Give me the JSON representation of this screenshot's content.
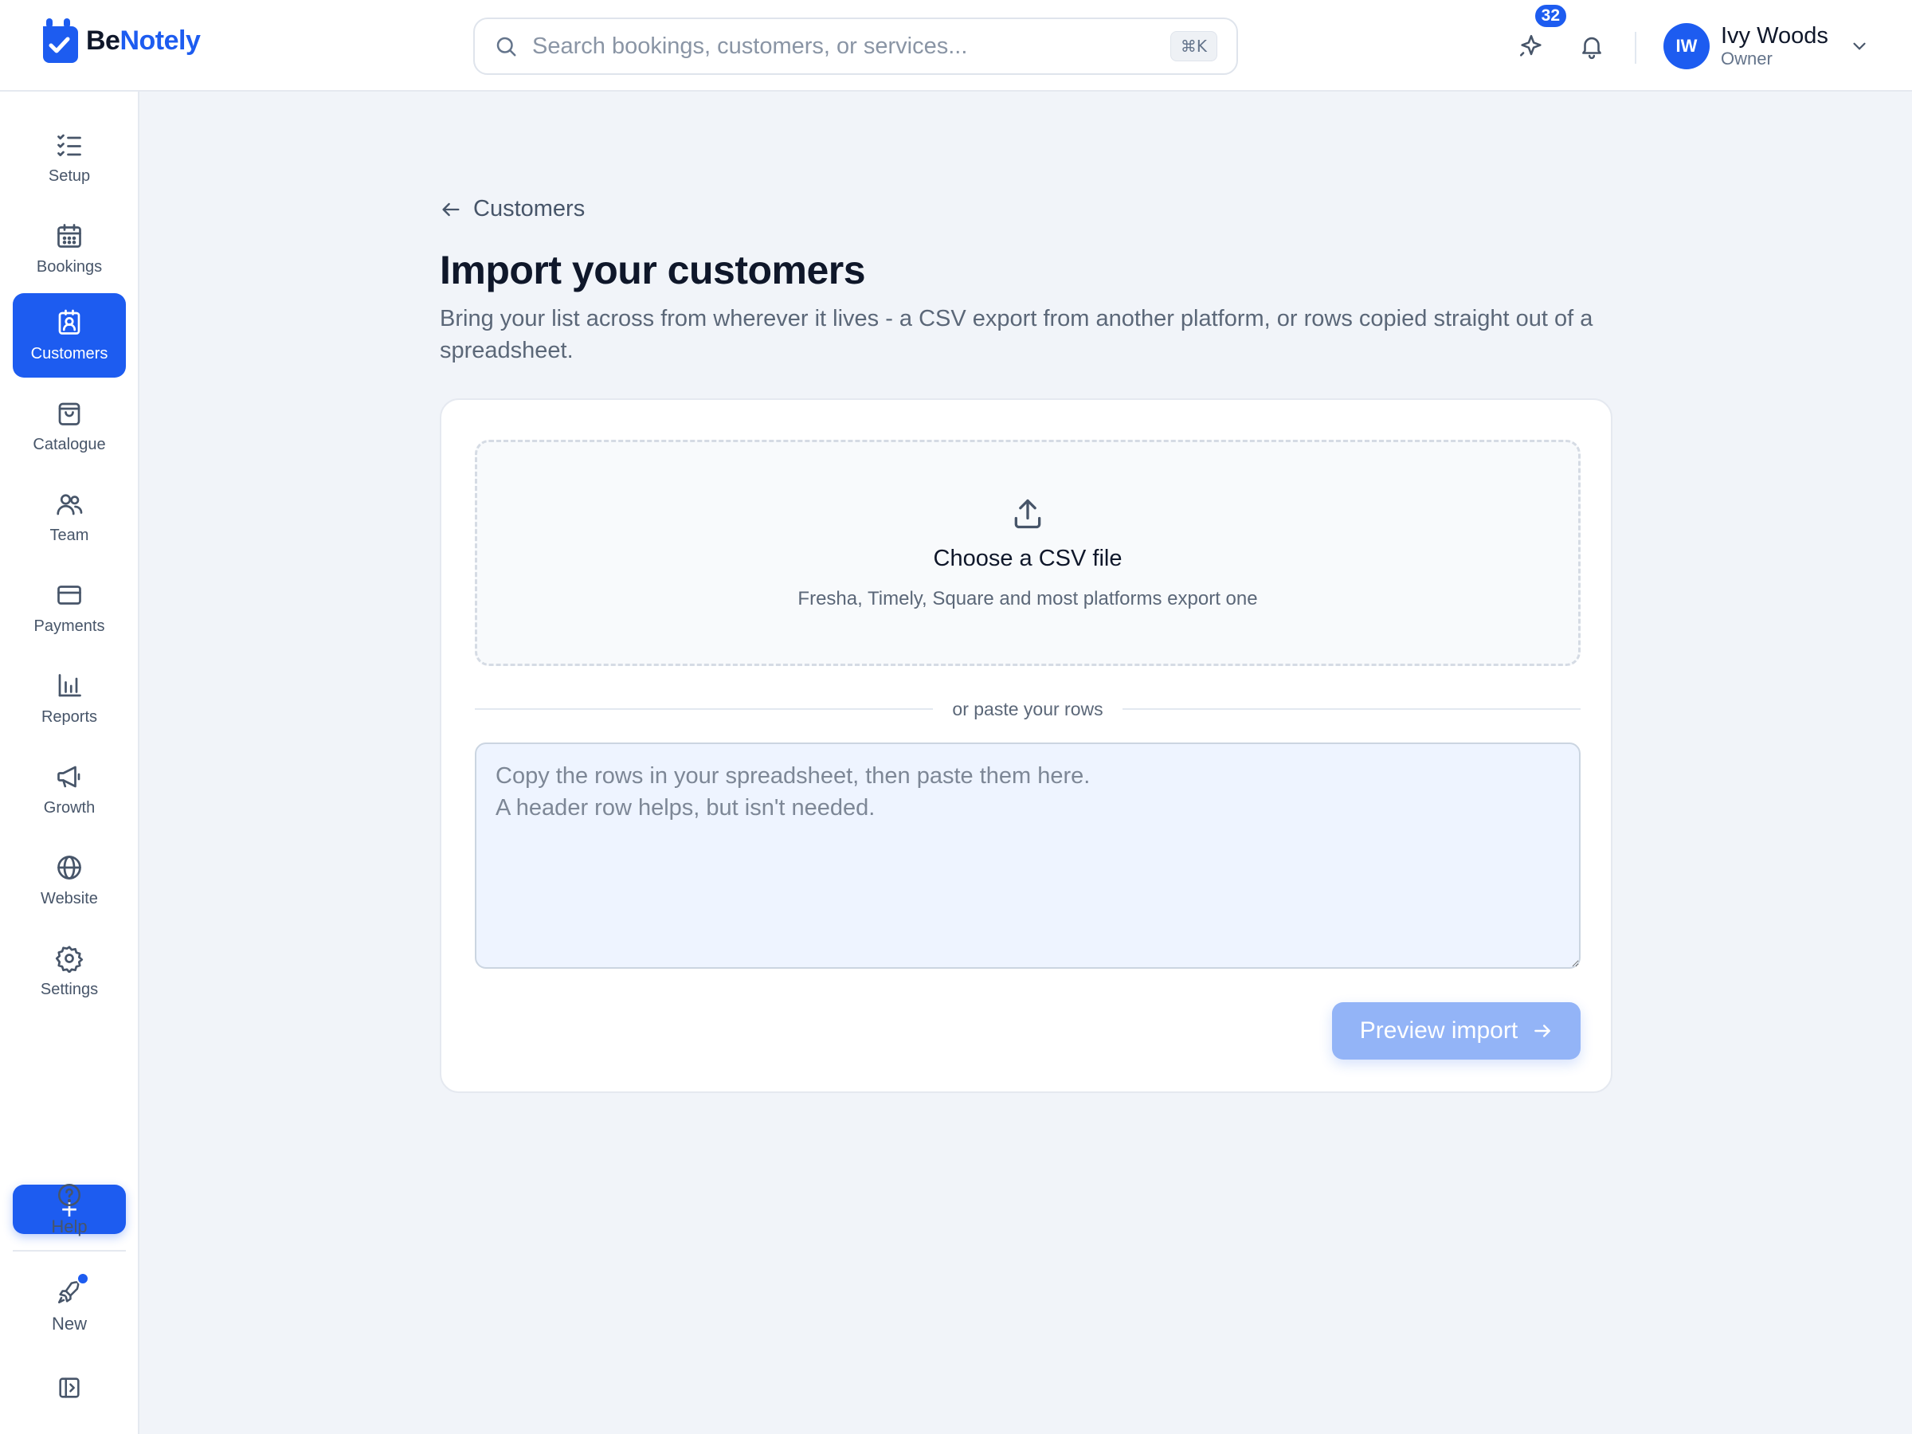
{
  "brand": {
    "name_part1": "Be",
    "name_part2": "Notely",
    "accent_color": "#1d5cf0"
  },
  "search": {
    "placeholder": "Search bookings, customers, or services...",
    "shortcut": "⌘K"
  },
  "header": {
    "whats_new_count": "32",
    "user": {
      "initials": "IW",
      "name": "Ivy Woods",
      "role": "Owner"
    }
  },
  "sidebar": {
    "items": [
      {
        "label": "Setup",
        "icon": "checklist-icon"
      },
      {
        "label": "Bookings",
        "icon": "calendar-icon"
      },
      {
        "label": "Customers",
        "icon": "contact-card-icon",
        "active": true
      },
      {
        "label": "Catalogue",
        "icon": "shopping-bag-icon"
      },
      {
        "label": "Team",
        "icon": "users-icon"
      },
      {
        "label": "Payments",
        "icon": "credit-card-icon"
      },
      {
        "label": "Reports",
        "icon": "bar-chart-icon"
      },
      {
        "label": "Growth",
        "icon": "megaphone-icon"
      },
      {
        "label": "Website",
        "icon": "globe-icon"
      },
      {
        "label": "Settings",
        "icon": "gear-icon"
      }
    ],
    "add_label": "+",
    "help_label": "Help",
    "new_label": "New"
  },
  "main": {
    "back_label": "Customers",
    "title": "Import your customers",
    "subtitle": "Bring your list across from wherever it lives - a CSV export from another platform, or rows copied straight out of a spreadsheet.",
    "dropzone": {
      "title": "Choose a CSV file",
      "subtitle": "Fresha, Timely, Square and most platforms export one"
    },
    "divider_label": "or paste your rows",
    "paste_placeholder": "Copy the rows in your spreadsheet, then paste them here.\nA header row helps, but isn't needed.",
    "preview_button": "Preview import"
  }
}
